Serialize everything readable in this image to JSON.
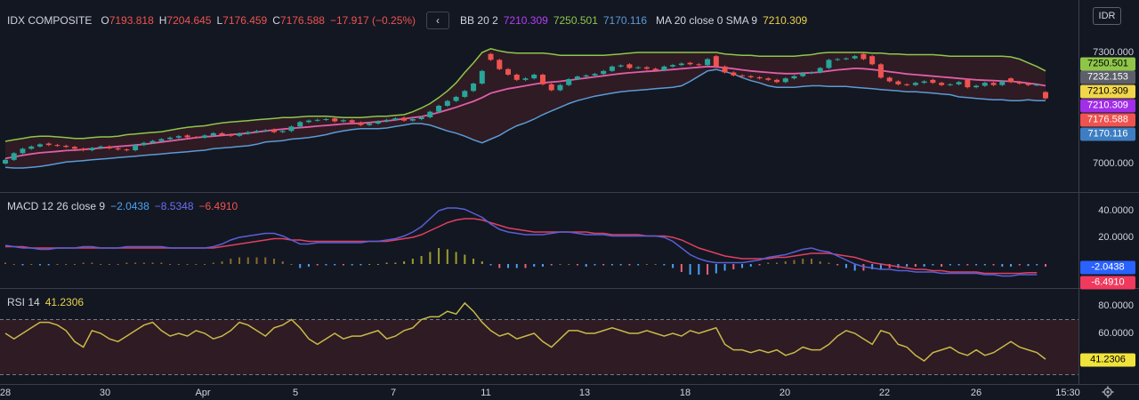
{
  "currency": "IDR",
  "time_label": "15:30",
  "nav_prev": "‹",
  "colors": {
    "bg": "#131722",
    "up": "#26a69a",
    "down": "#ef5350",
    "bb_upper": "#8fc64a",
    "bb_lower": "#5b9bd5",
    "bb_basis": "#e05ea8",
    "macd": "#5a5fd6",
    "signal": "#e0405f",
    "rsi": "#c9b94a"
  },
  "main": {
    "symbol": "IDX COMPOSITE",
    "o_label": "O",
    "o": "7193.818",
    "h_label": "H",
    "h": "7204.645",
    "l_label": "L",
    "l": "7176.459",
    "c_label": "C",
    "c": "7176.588",
    "change": "−17.917 (−0.25%)",
    "bb_label": "BB 20 2",
    "bb_basis": "7210.309",
    "bb_upper": "7250.501",
    "bb_lower": "7170.116",
    "ma_label": "MA 20 close 0 SMA 9",
    "ma_value": "7210.309"
  },
  "macd": {
    "label": "MACD 12 26 close 9",
    "hist": "−2.0438",
    "macd": "−8.5348",
    "signal": "−6.4910"
  },
  "rsi": {
    "label": "RSI 14",
    "value": "41.2306"
  },
  "y_ticks": {
    "price": [
      "7300.000",
      "7000.000"
    ],
    "macd": [
      "40.0000",
      "20.0000"
    ],
    "rsi": [
      "80.0000",
      "60.0000"
    ]
  },
  "price_tags": [
    {
      "text": "7250.501",
      "bg": "#8fc64a",
      "fg": "#000000"
    },
    {
      "text": "7232.153",
      "bg": "#5d606b",
      "fg": "#ffffff"
    },
    {
      "text": "7210.309",
      "bg": "#f0d64b",
      "fg": "#000000"
    },
    {
      "text": "7210.309",
      "bg": "#a12ee8",
      "fg": "#ffffff"
    },
    {
      "text": "7176.588",
      "bg": "#ef5350",
      "fg": "#ffffff"
    },
    {
      "text": "7170.116",
      "bg": "#3d7ec2",
      "fg": "#ffffff"
    }
  ],
  "macd_tags": [
    {
      "text": "-2.0438",
      "bg": "#2962ff",
      "fg": "#ffffff"
    },
    {
      "text": "-6.4910",
      "bg": "#ef3a5d",
      "fg": "#ffffff"
    }
  ],
  "rsi_tag": {
    "text": "41.2306",
    "bg": "#f0e33b",
    "fg": "#000000"
  },
  "x_labels": [
    "28",
    "30",
    "Apr",
    "5",
    "7",
    "11",
    "13",
    "18",
    "20",
    "22",
    "26"
  ],
  "chart_data": {
    "type": "candlestick",
    "price_ylim": [
      6980,
      7360
    ],
    "close": [
      7010,
      7028,
      7040,
      7046,
      7052,
      7050,
      7048,
      7045,
      7040,
      7036,
      7042,
      7046,
      7041,
      7038,
      7036,
      7050,
      7056,
      7061,
      7066,
      7070,
      7074,
      7071,
      7070,
      7076,
      7082,
      7078,
      7075,
      7081,
      7085,
      7088,
      7090,
      7085,
      7088,
      7100,
      7112,
      7116,
      7118,
      7120,
      7114,
      7117,
      7111,
      7104,
      7108,
      7114,
      7118,
      7122,
      7116,
      7120,
      7125,
      7140,
      7156,
      7169,
      7180,
      7196,
      7216,
      7250,
      7280,
      7255,
      7240,
      7226,
      7230,
      7240,
      7214,
      7198,
      7212,
      7228,
      7235,
      7238,
      7242,
      7250,
      7262,
      7265,
      7258,
      7260,
      7256,
      7252,
      7262,
      7266,
      7270,
      7268,
      7266,
      7282,
      7262,
      7246,
      7238,
      7236,
      7233,
      7230,
      7226,
      7220,
      7230,
      7236,
      7244,
      7246,
      7258,
      7280,
      7282,
      7284,
      7290,
      7282,
      7268,
      7232,
      7222,
      7214,
      7212,
      7218,
      7222,
      7218,
      7212,
      7214,
      7220,
      7206,
      7210,
      7218,
      7212,
      7222,
      7220,
      7216,
      7212,
      7213,
      7176
    ],
    "open": [
      7000,
      7010,
      7028,
      7040,
      7046,
      7054,
      7050,
      7048,
      7045,
      7040,
      7036,
      7042,
      7046,
      7041,
      7038,
      7036,
      7050,
      7056,
      7061,
      7066,
      7070,
      7076,
      7071,
      7070,
      7076,
      7082,
      7078,
      7075,
      7081,
      7085,
      7088,
      7092,
      7085,
      7088,
      7100,
      7112,
      7116,
      7118,
      7122,
      7114,
      7117,
      7111,
      7104,
      7108,
      7114,
      7118,
      7124,
      7116,
      7120,
      7125,
      7140,
      7156,
      7169,
      7180,
      7196,
      7216,
      7296,
      7280,
      7255,
      7240,
      7226,
      7230,
      7240,
      7214,
      7198,
      7212,
      7228,
      7235,
      7238,
      7242,
      7250,
      7262,
      7268,
      7258,
      7260,
      7256,
      7252,
      7262,
      7266,
      7272,
      7268,
      7266,
      7290,
      7262,
      7246,
      7238,
      7236,
      7233,
      7230,
      7226,
      7220,
      7230,
      7236,
      7244,
      7246,
      7258,
      7280,
      7282,
      7284,
      7296,
      7290,
      7268,
      7232,
      7222,
      7214,
      7212,
      7218,
      7226,
      7218,
      7212,
      7214,
      7226,
      7206,
      7210,
      7218,
      7212,
      7230,
      7220,
      7216,
      7212,
      7193
    ],
    "bb_upper": [
      7060,
      7064,
      7068,
      7072,
      7074,
      7074,
      7072,
      7070,
      7068,
      7068,
      7070,
      7072,
      7072,
      7074,
      7078,
      7080,
      7082,
      7084,
      7086,
      7090,
      7094,
      7098,
      7100,
      7102,
      7106,
      7110,
      7112,
      7114,
      7116,
      7118,
      7120,
      7122,
      7124,
      7124,
      7126,
      7128,
      7128,
      7128,
      7126,
      7124,
      7124,
      7124,
      7126,
      7128,
      7128,
      7130,
      7132,
      7140,
      7150,
      7162,
      7178,
      7196,
      7218,
      7246,
      7272,
      7300,
      7310,
      7304,
      7300,
      7298,
      7298,
      7298,
      7298,
      7296,
      7292,
      7292,
      7292,
      7292,
      7292,
      7292,
      7294,
      7296,
      7298,
      7300,
      7300,
      7300,
      7300,
      7300,
      7300,
      7300,
      7300,
      7300,
      7300,
      7296,
      7294,
      7292,
      7292,
      7290,
      7290,
      7290,
      7290,
      7290,
      7292,
      7294,
      7298,
      7300,
      7300,
      7300,
      7300,
      7300,
      7298,
      7298,
      7296,
      7296,
      7294,
      7294,
      7294,
      7294,
      7292,
      7290,
      7290,
      7290,
      7290,
      7290,
      7290,
      7290,
      7288,
      7282,
      7272,
      7262,
      7250
    ],
    "bb_basis": [
      7014,
      7018,
      7022,
      7026,
      7029,
      7031,
      7033,
      7035,
      7036,
      7038,
      7040,
      7042,
      7044,
      7046,
      7048,
      7050,
      7052,
      7055,
      7058,
      7061,
      7064,
      7067,
      7070,
      7072,
      7074,
      7076,
      7078,
      7080,
      7082,
      7085,
      7088,
      7091,
      7093,
      7095,
      7097,
      7099,
      7101,
      7103,
      7105,
      7107,
      7108,
      7109,
      7111,
      7113,
      7115,
      7118,
      7121,
      7124,
      7127,
      7132,
      7138,
      7145,
      7152,
      7160,
      7168,
      7178,
      7190,
      7196,
      7202,
      7206,
      7210,
      7214,
      7218,
      7220,
      7222,
      7225,
      7228,
      7231,
      7234,
      7237,
      7240,
      7243,
      7245,
      7247,
      7249,
      7250,
      7252,
      7254,
      7256,
      7258,
      7260,
      7262,
      7261,
      7259,
      7256,
      7253,
      7250,
      7248,
      7246,
      7244,
      7243,
      7243,
      7244,
      7245,
      7247,
      7250,
      7253,
      7255,
      7257,
      7256,
      7254,
      7251,
      7248,
      7245,
      7242,
      7240,
      7238,
      7236,
      7234,
      7232,
      7230,
      7228,
      7226,
      7225,
      7224,
      7223,
      7222,
      7220,
      7217,
      7214,
      7210
    ],
    "bb_lower": [
      6990,
      6988,
      6988,
      6990,
      6992,
      6996,
      7000,
      7004,
      7006,
      7008,
      7010,
      7012,
      7014,
      7016,
      7018,
      7020,
      7022,
      7024,
      7026,
      7028,
      7030,
      7032,
      7034,
      7036,
      7040,
      7042,
      7044,
      7046,
      7048,
      7052,
      7058,
      7060,
      7062,
      7066,
      7068,
      7070,
      7074,
      7078,
      7084,
      7088,
      7092,
      7094,
      7094,
      7094,
      7096,
      7100,
      7104,
      7108,
      7108,
      7104,
      7096,
      7088,
      7082,
      7074,
      7064,
      7056,
      7066,
      7076,
      7090,
      7102,
      7110,
      7120,
      7132,
      7142,
      7152,
      7162,
      7170,
      7176,
      7182,
      7186,
      7190,
      7194,
      7196,
      7198,
      7200,
      7202,
      7204,
      7206,
      7210,
      7222,
      7236,
      7250,
      7254,
      7248,
      7242,
      7232,
      7224,
      7218,
      7210,
      7206,
      7206,
      7206,
      7208,
      7210,
      7210,
      7208,
      7208,
      7208,
      7206,
      7204,
      7202,
      7200,
      7198,
      7196,
      7194,
      7194,
      7192,
      7190,
      7188,
      7186,
      7180,
      7178,
      7176,
      7174,
      7172,
      7172,
      7170,
      7170,
      7172,
      7170,
      7170
    ],
    "macd_ylim": [
      -12,
      46
    ],
    "macd_line": [
      14,
      13,
      12,
      12,
      11,
      11,
      12,
      12,
      12,
      13,
      13,
      12,
      12,
      12,
      13,
      13,
      13,
      13,
      13,
      12,
      12,
      12,
      12,
      12,
      13,
      15,
      18,
      20,
      21,
      22,
      23,
      23,
      21,
      18,
      15,
      15,
      16,
      16,
      16,
      16,
      16,
      16,
      17,
      17,
      18,
      19,
      21,
      24,
      28,
      34,
      40,
      42,
      42,
      41,
      38,
      35,
      30,
      26,
      24,
      23,
      22,
      22,
      22,
      23,
      24,
      24,
      23,
      22,
      22,
      22,
      21,
      21,
      21,
      21,
      21,
      21,
      20,
      17,
      12,
      7,
      4,
      2,
      1,
      1,
      1,
      1,
      2,
      3,
      5,
      6,
      7,
      9,
      11,
      12,
      10,
      9,
      6,
      3,
      0,
      -2,
      -3,
      -4,
      -4,
      -5,
      -5,
      -6,
      -6,
      -6,
      -7,
      -7,
      -7,
      -7,
      -7,
      -8,
      -8,
      -9,
      -9,
      -8,
      -8,
      -8
    ],
    "signal_line": [
      13,
      13,
      13,
      12,
      12,
      12,
      12,
      12,
      12,
      12,
      12,
      12,
      12,
      12,
      12,
      12,
      12,
      12,
      12,
      12,
      12,
      12,
      12,
      12,
      12,
      13,
      14,
      15,
      16,
      17,
      18,
      19,
      19,
      18,
      18,
      17,
      17,
      17,
      17,
      17,
      17,
      17,
      17,
      17,
      17,
      18,
      19,
      20,
      22,
      25,
      28,
      31,
      33,
      34,
      34,
      33,
      31,
      29,
      27,
      26,
      25,
      24,
      24,
      24,
      24,
      24,
      24,
      24,
      23,
      23,
      22,
      22,
      22,
      22,
      21,
      21,
      21,
      20,
      18,
      15,
      12,
      10,
      8,
      6,
      5,
      4,
      4,
      4,
      4,
      5,
      5,
      6,
      7,
      8,
      8,
      8,
      7,
      6,
      5,
      3,
      1,
      0,
      -1,
      -2,
      -3,
      -4,
      -4,
      -5,
      -5,
      -6,
      -6,
      -6,
      -6,
      -7,
      -7,
      -7,
      -7,
      -7,
      -6.5,
      -6.5
    ],
    "macd_hist": [
      1,
      0,
      -1,
      0,
      -1,
      -1,
      0,
      0,
      0,
      1,
      1,
      0,
      0,
      0,
      1,
      1,
      1,
      1,
      1,
      0,
      0,
      0,
      0,
      0,
      1,
      2,
      4,
      5,
      5,
      5,
      5,
      4,
      2,
      0,
      -3,
      -2,
      -1,
      -1,
      -1,
      -1,
      -1,
      -1,
      0,
      0,
      1,
      1,
      2,
      4,
      6,
      9,
      12,
      11,
      9,
      7,
      4,
      2,
      -1,
      -3,
      -3,
      -3,
      -3,
      -2,
      -2,
      -1,
      0,
      0,
      -1,
      -2,
      -1,
      -1,
      -1,
      -1,
      -1,
      -1,
      0,
      0,
      -1,
      -3,
      -6,
      -8,
      -8,
      -8,
      -7,
      -5,
      -4,
      -3,
      -2,
      -1,
      1,
      1,
      2,
      3,
      4,
      4,
      2,
      1,
      -1,
      -3,
      -5,
      -5,
      -4,
      -4,
      -3,
      -3,
      -2,
      -2,
      -2,
      -1,
      -2,
      -1,
      -1,
      -1,
      -1,
      -1,
      -1,
      -2,
      -2,
      -1,
      -1.5,
      -1,
      -2
    ],
    "rsi_ylim": [
      20,
      100
    ],
    "rsi_upper_band": 70,
    "rsi_lower_band": 30,
    "rsi": [
      60,
      56,
      60,
      64,
      68,
      68,
      66,
      62,
      54,
      50,
      62,
      60,
      56,
      54,
      58,
      62,
      66,
      68,
      62,
      58,
      60,
      58,
      62,
      60,
      56,
      58,
      62,
      68,
      66,
      62,
      58,
      64,
      66,
      70,
      64,
      56,
      52,
      56,
      60,
      56,
      58,
      58,
      60,
      62,
      56,
      58,
      62,
      64,
      70,
      72,
      72,
      76,
      74,
      82,
      76,
      68,
      62,
      58,
      60,
      56,
      58,
      60,
      54,
      50,
      56,
      62,
      62,
      60,
      60,
      62,
      64,
      62,
      60,
      60,
      62,
      60,
      58,
      60,
      58,
      62,
      60,
      62,
      64,
      52,
      48,
      48,
      46,
      48,
      46,
      48,
      44,
      46,
      50,
      48,
      48,
      52,
      58,
      62,
      60,
      56,
      52,
      62,
      60,
      52,
      50,
      44,
      40,
      46,
      48,
      50,
      46,
      44,
      48,
      44,
      46,
      50,
      54,
      50,
      48,
      46,
      41.2
    ]
  }
}
